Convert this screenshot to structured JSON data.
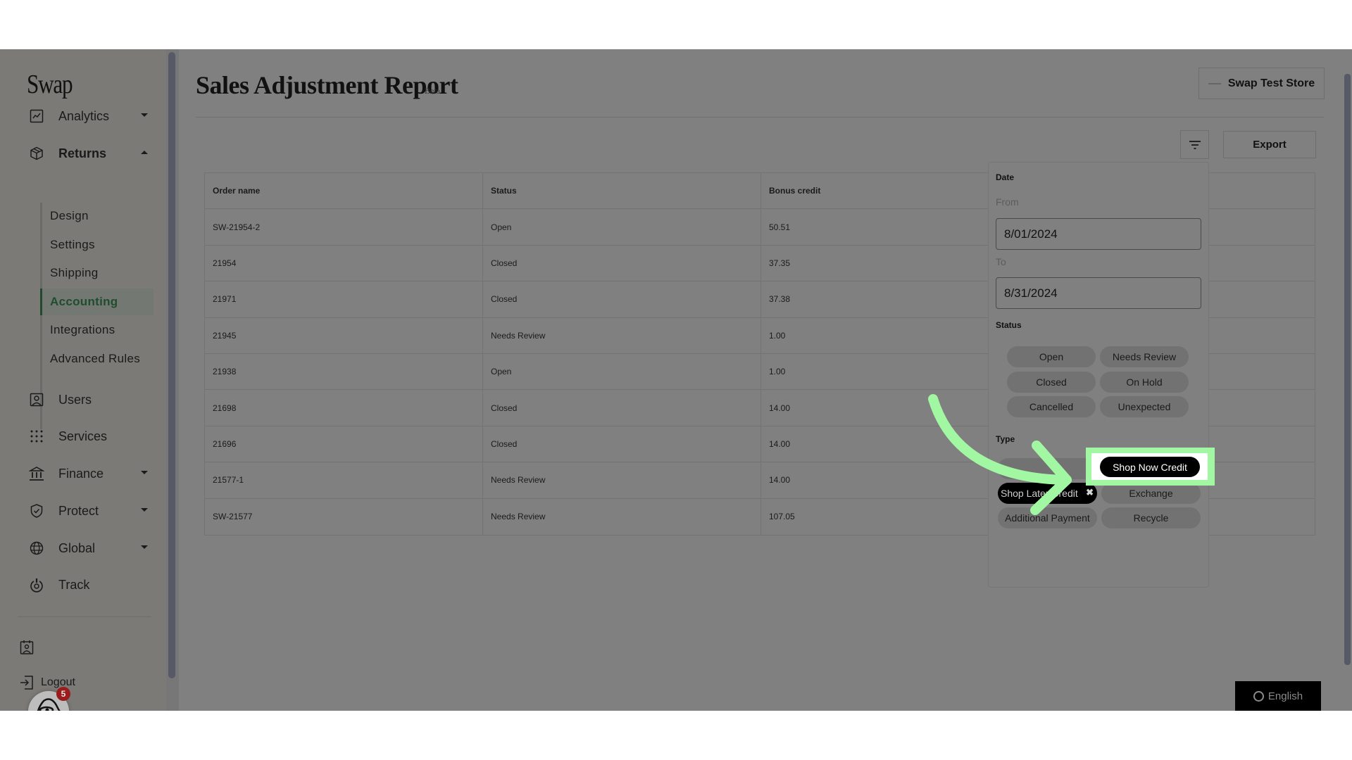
{
  "sidebar": {
    "logo": "Swap",
    "items": [
      {
        "label": "Analytics",
        "icon": "chart-icon",
        "expandable": true,
        "expanded": false
      },
      {
        "label": "Returns",
        "icon": "box-icon",
        "expandable": true,
        "expanded": true
      },
      {
        "label": "Users",
        "icon": "user-icon",
        "expandable": false
      },
      {
        "label": "Services",
        "icon": "grid-icon",
        "expandable": false
      },
      {
        "label": "Finance",
        "icon": "bank-icon",
        "expandable": true,
        "expanded": false
      },
      {
        "label": "Protect",
        "icon": "shield-icon",
        "expandable": true,
        "expanded": false
      },
      {
        "label": "Global",
        "icon": "globe-icon",
        "expandable": true,
        "expanded": false
      },
      {
        "label": "Track",
        "icon": "track-icon",
        "expandable": false
      }
    ],
    "returns_sub": [
      {
        "label": "Design",
        "active": false
      },
      {
        "label": "Settings",
        "active": false
      },
      {
        "label": "Shipping",
        "active": false
      },
      {
        "label": "Accounting",
        "active": true
      },
      {
        "label": "Integrations",
        "active": false
      },
      {
        "label": "Advanced Rules",
        "active": false
      }
    ],
    "bottom": {
      "account_label": "",
      "logout_label": "Logout",
      "chat_badge": "5"
    }
  },
  "header": {
    "title": "Sales Adjustment Report",
    "badge": "Beta",
    "store_label": "Swap Test Store"
  },
  "toolbar": {
    "filter_icon": "filter-icon",
    "export_label": "Export"
  },
  "table": {
    "columns": [
      "Order name",
      "Status",
      "Bonus credit",
      ""
    ],
    "rows": [
      [
        "SW-21954-2",
        "Open",
        "50.51",
        ""
      ],
      [
        "21954",
        "Closed",
        "37.35",
        ""
      ],
      [
        "21971",
        "Closed",
        "37.38",
        ""
      ],
      [
        "21945",
        "Needs Review",
        "1.00",
        ""
      ],
      [
        "21938",
        "Open",
        "1.00",
        ""
      ],
      [
        "21698",
        "Closed",
        "14.00",
        ""
      ],
      [
        "21696",
        "Closed",
        "14.00",
        ""
      ],
      [
        "21577-1",
        "Needs Review",
        "14.00",
        ""
      ],
      [
        "SW-21577",
        "Needs Review",
        "107.05",
        ""
      ]
    ]
  },
  "filter_panel": {
    "date_label": "Date",
    "from_label": "From",
    "from_value": "8/01/2024",
    "to_label": "To",
    "to_value": "8/31/2024",
    "status_label": "Status",
    "status_options": [
      "Open",
      "Needs Review",
      "Closed",
      "On Hold",
      "Cancelled",
      "Unexpected"
    ],
    "type_label": "Type",
    "type_options": [
      {
        "label": "",
        "selected": false
      },
      {
        "label": "Shop Now Credit",
        "selected": true,
        "highlighted": true
      },
      {
        "label": "Shop Later Credit",
        "selected": true
      },
      {
        "label": "Exchange",
        "selected": false
      },
      {
        "label": "Additional Payment",
        "selected": false
      },
      {
        "label": "Recycle",
        "selected": false
      }
    ],
    "remove_glyph": "✖"
  },
  "annotation": {
    "arrow_color": "#a2f7a2",
    "highlight_color": "#a2f7a2"
  },
  "footer": {
    "language_label": "English"
  }
}
